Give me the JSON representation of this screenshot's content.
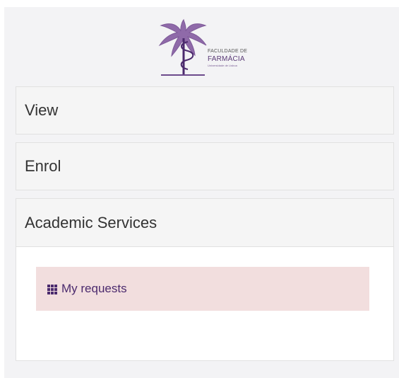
{
  "logo": {
    "line1": "Faculdade de",
    "line2": "FARMÁCIA",
    "line3": "Universidade de Lisboa"
  },
  "menu": {
    "view": "View",
    "enrol": "Enrol",
    "academic_services": "Academic Services",
    "my_requests": "My requests"
  },
  "icons": {
    "logo": "palm-tree-icon",
    "my_requests": "grid-icon"
  },
  "colors": {
    "panel": "#f3f3f5",
    "menu": "#f5f5f5",
    "highlight": "#f2dede",
    "purple": "#4b2a6d"
  }
}
